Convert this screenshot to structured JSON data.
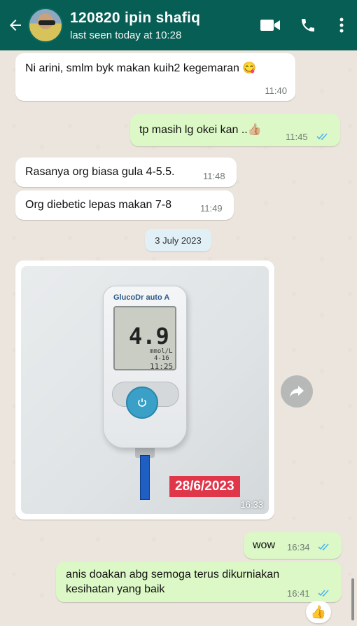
{
  "header": {
    "contact_name": "120820 ipin shafiq",
    "last_seen": "last seen today at 10:28",
    "icons": [
      "back-arrow-icon",
      "video-call-icon",
      "phone-icon",
      "more-options-icon"
    ],
    "color": "#075e54"
  },
  "messages": [
    {
      "direction": "in",
      "text": "Ni arini, smlm byk makan kuih2 kegemaran",
      "emoji": "😋",
      "time": "11:40"
    },
    {
      "direction": "out",
      "text": "tp masih lg okei kan ..",
      "emoji": "👍🏼",
      "time": "11:45",
      "status": "read"
    },
    {
      "direction": "in",
      "text": "Rasanya org biasa gula 4-5.5.",
      "time": "11:48"
    },
    {
      "direction": "in",
      "text": "Org diebetic lepas makan 7-8",
      "time": "11:49"
    },
    {
      "direction": "out",
      "text": "wow",
      "time": "16:34",
      "status": "read"
    },
    {
      "direction": "out",
      "text": "anis doakan abg semoga terus dikurniakan kesihatan yang baik",
      "time": "16:41",
      "status": "read"
    }
  ],
  "date_separator": "3 July 2023",
  "image_message": {
    "direction": "in",
    "time": "16:33",
    "photo": {
      "meter_brand": "GlucoDr auto A",
      "reading": "4.9",
      "unit": "mmol/L",
      "meter_date": "4-16",
      "meter_time": "11:25",
      "stamp_date": "28/6/2023"
    }
  },
  "reaction": "👍",
  "colors": {
    "incoming_bubble": "#ffffff",
    "outgoing_bubble": "#dcf8c6",
    "read_tick": "#4fb6ec",
    "chat_background": "#ece5dd"
  }
}
